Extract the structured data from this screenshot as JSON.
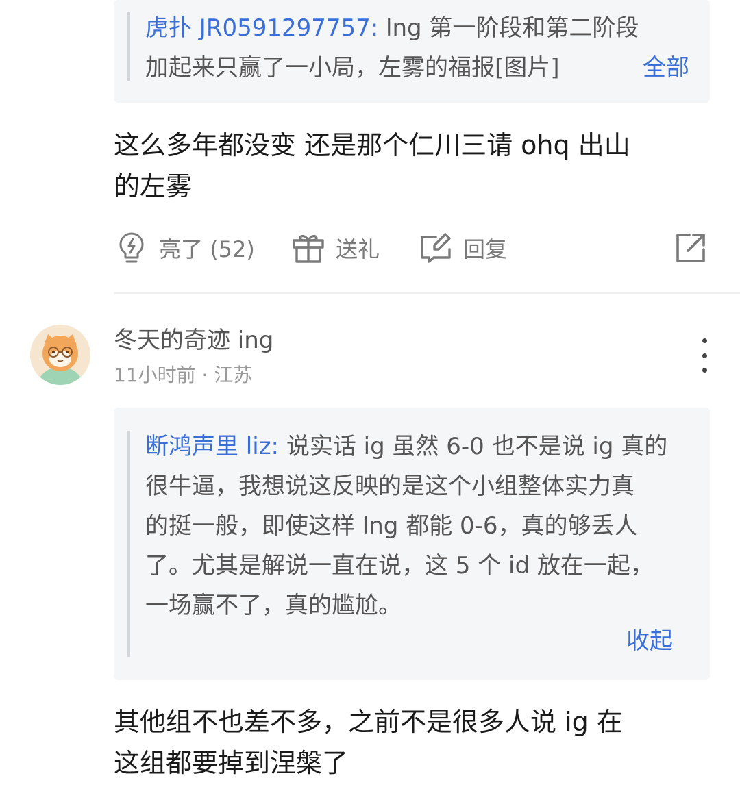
{
  "comment1": {
    "quote": {
      "author": "虎扑 JR0591297757:",
      "text_line1": " lng 第一阶段和第二阶段",
      "text_line2": "加起来只赢了一小局，左雾的福报[图片]",
      "expand_label": "全部"
    },
    "body_line1": "这么多年都没变 还是那个仁川三请 ohq 出山",
    "body_line2": "的左雾",
    "actions": {
      "like_label": "亮了 (52)",
      "gift_label": "送礼",
      "reply_label": "回复"
    }
  },
  "comment2": {
    "username": "冬天的奇迹 ing",
    "meta": "11小时前 · 江苏",
    "quote": {
      "author": "断鸿声里 liz:",
      "lines": [
        " 说实话 ig 虽然 6-0 也不是说 ig 真的",
        "很牛逼，我想说这反映的是这个小组整体实力真",
        "的挺一般，即使这样 lng 都能 0-6，真的够丢人",
        "了。尤其是解说一直在说，这 5 个 id 放在一起，",
        "一场赢不了，真的尴尬。"
      ],
      "collapse_label": "收起"
    },
    "body_line1": "其他组不也差不多，之前不是很多人说 ig 在",
    "body_line2": "这组都要掉到涅槃了"
  },
  "icons": {
    "like": "lightbulb-icon",
    "gift": "gift-icon",
    "reply": "edit-reply-icon",
    "share": "share-icon",
    "more": "more-vertical-icon"
  },
  "colors": {
    "link": "#3a6fd8",
    "quote_bg": "#f5f6f8",
    "muted": "#7a7a7a"
  }
}
